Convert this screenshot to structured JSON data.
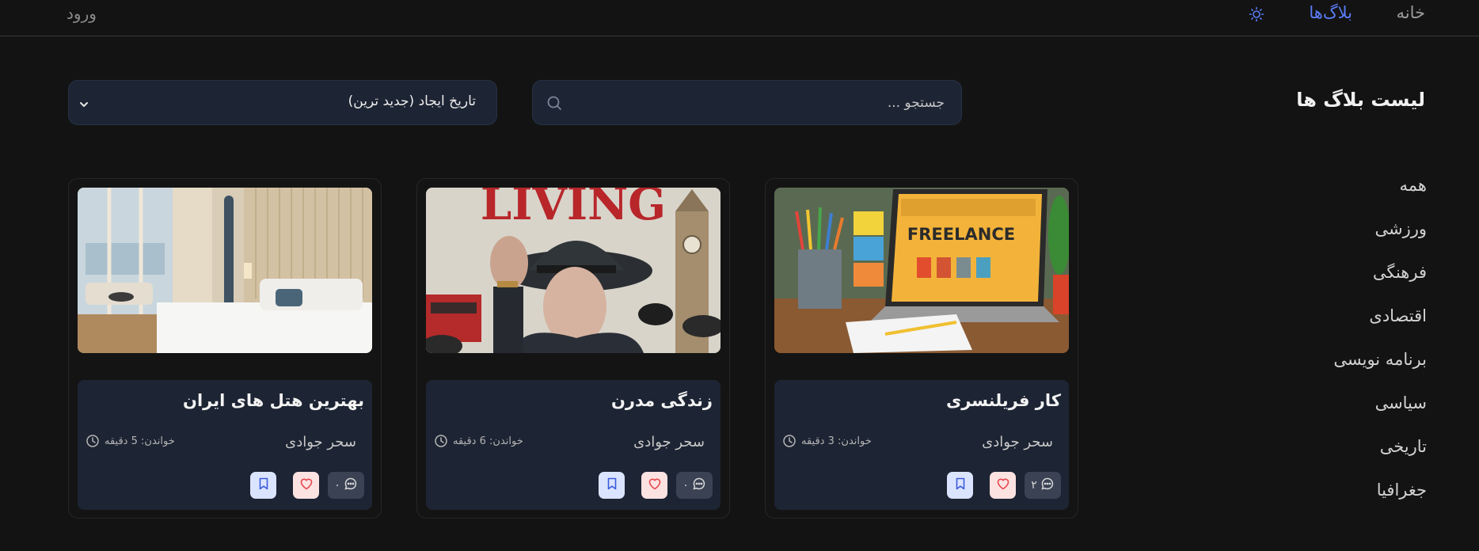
{
  "header": {
    "nav_home": "خانه",
    "nav_blogs": "بلاگ‌ها",
    "login": "ورود",
    "theme_icon": "sun-icon",
    "active_color": "#5a7cf5"
  },
  "page": {
    "title": "لیست بلاگ ها"
  },
  "search": {
    "placeholder": "جستجو ..."
  },
  "sort": {
    "selected": "تاریخ ایجاد (جدید ترین)"
  },
  "categories": [
    "همه",
    "ورزشی",
    "فرهنگی",
    "اقتصادی",
    "برنامه نویسی",
    "سیاسی",
    "تاریخی",
    "جغرافیا"
  ],
  "cards": [
    {
      "title": "کار فریلنسری",
      "author": "سحر جوادی",
      "read_time": "خواندن: 3 دقیقه",
      "comments": "۲",
      "image_text": "FREELANCE"
    },
    {
      "title": "زندگی مدرن",
      "author": "سحر جوادی",
      "read_time": "خواندن: 6 دقیقه",
      "comments": "۰",
      "image_text": "LIVING"
    },
    {
      "title": "بهترین هتل های ایران",
      "author": "سحر جوادی",
      "read_time": "خواندن: 5 دقیقه",
      "comments": "۰",
      "image_text": ""
    }
  ],
  "colors": {
    "background": "#131313",
    "card_body": "#1d2433",
    "like_bg": "#fde2e2",
    "bookmark_bg": "#dbe4ff",
    "comment_bg": "#3a4254"
  }
}
